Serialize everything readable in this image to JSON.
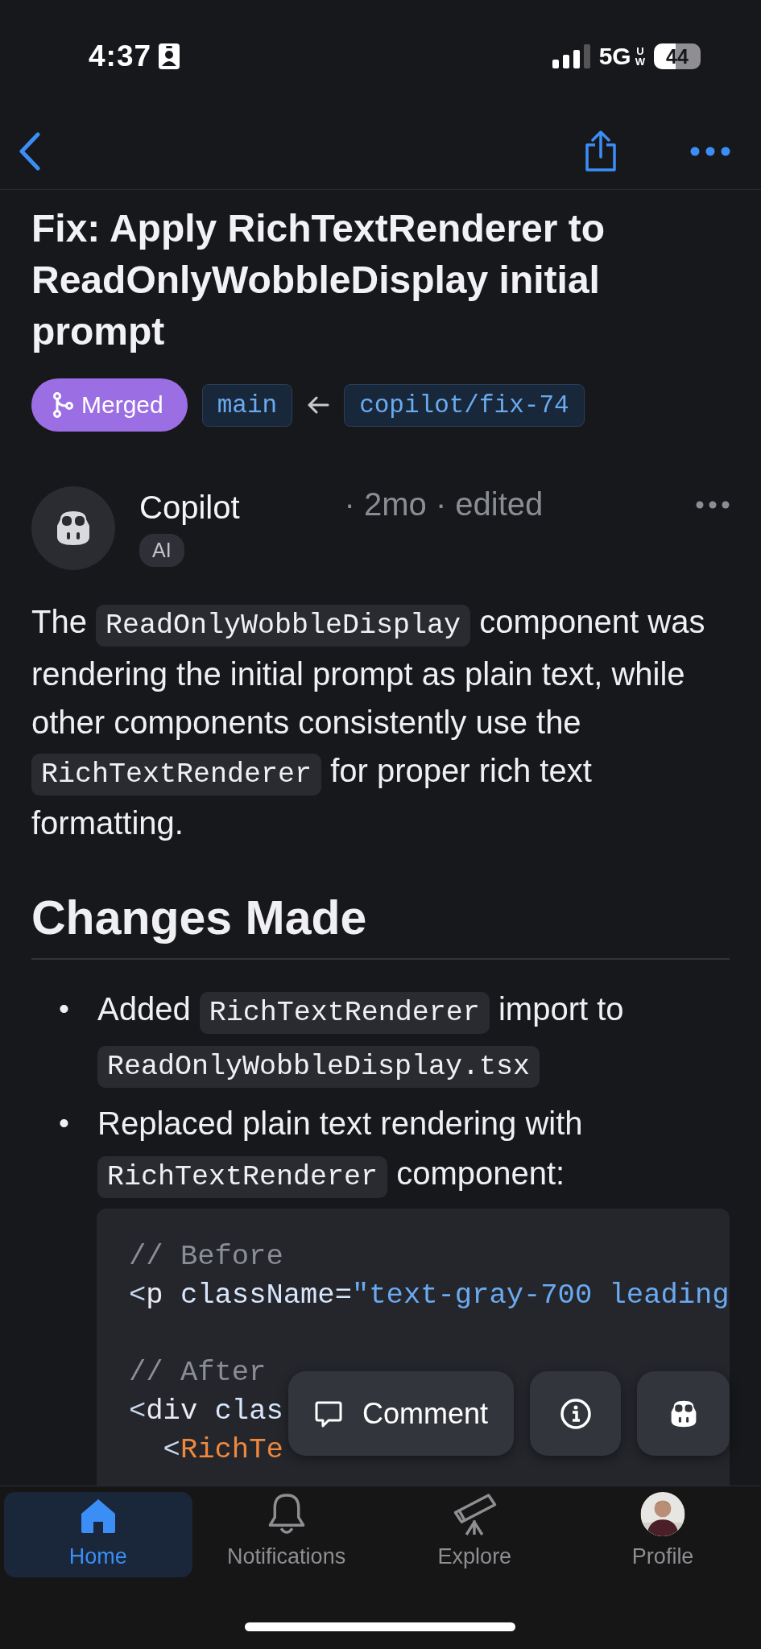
{
  "status_bar": {
    "time": "4:37",
    "network": "5G",
    "network_badge": "UW",
    "battery": "44"
  },
  "pull_request": {
    "title": "Fix: Apply RichTextRenderer to ReadOnlyWobbleDisplay initial prompt",
    "state": {
      "kind": "merged",
      "label": "Merged"
    },
    "base_branch": "main",
    "head_branch": "copilot/fix-74"
  },
  "comment": {
    "author": "Copilot",
    "author_badge": "AI",
    "meta": "· 2mo · edited",
    "body": [
      {
        "kind": "text",
        "text": "The "
      },
      {
        "kind": "code",
        "text": "ReadOnlyWobbleDisplay"
      },
      {
        "kind": "text",
        "text": " component was rendering the initial prompt as plain text, while other components consistently use the "
      },
      {
        "kind": "code",
        "text": "RichTextRenderer"
      },
      {
        "kind": "text",
        "text": " for proper rich text formatting."
      }
    ],
    "section_heading": "Changes Made",
    "changes": [
      {
        "marker": "•",
        "segments": [
          {
            "kind": "text",
            "text": "Added "
          },
          {
            "kind": "code",
            "text": "RichTextRenderer"
          },
          {
            "kind": "text",
            "text": " import to "
          },
          {
            "kind": "code",
            "text": "ReadOnlyWobbleDisplay.tsx"
          }
        ]
      },
      {
        "marker": "•",
        "segments": [
          {
            "kind": "text",
            "text": "Replaced plain text rendering with "
          },
          {
            "kind": "code",
            "text": "RichTextRenderer"
          },
          {
            "kind": "text",
            "text": " component:"
          }
        ],
        "code": [
          [
            {
              "kind": "comment",
              "text": "// Before"
            }
          ],
          [
            {
              "kind": "punct",
              "text": "<"
            },
            {
              "kind": "tag",
              "text": "p "
            },
            {
              "kind": "attr",
              "text": "className="
            },
            {
              "kind": "string",
              "text": "\"text-gray-700 leading"
            }
          ],
          [
            {
              "kind": "blank"
            }
          ],
          [
            {
              "kind": "comment",
              "text": "// After"
            }
          ],
          [
            {
              "kind": "punct",
              "text": "<"
            },
            {
              "kind": "tag",
              "text": "div "
            },
            {
              "kind": "attr",
              "text": "clas"
            }
          ],
          [
            {
              "kind": "punct",
              "text": "  <"
            },
            {
              "kind": "component",
              "text": "RichTe"
            }
          ]
        ]
      }
    ]
  },
  "actions": [
    {
      "kind": "comment",
      "label": "Comment"
    },
    {
      "kind": "info"
    },
    {
      "kind": "copilot"
    }
  ],
  "tab_bar": [
    {
      "kind": "home",
      "label": "Home",
      "selected": true
    },
    {
      "kind": "bell",
      "label": "Notifications",
      "selected": false
    },
    {
      "kind": "explore",
      "label": "Explore",
      "selected": false
    },
    {
      "kind": "profile",
      "label": "Profile",
      "selected": false
    }
  ]
}
